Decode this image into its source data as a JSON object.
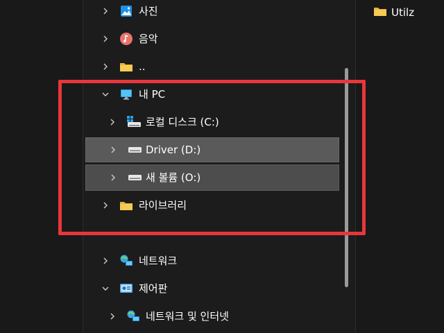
{
  "nav": {
    "items": [
      {
        "label": "사진",
        "icon": "photos-icon",
        "expanded": false
      },
      {
        "label": "음악",
        "icon": "music-icon",
        "expanded": false
      },
      {
        "label": "..",
        "icon": "folder-icon",
        "expanded": false
      },
      {
        "label": "내 PC",
        "icon": "this-pc-icon",
        "expanded": true
      },
      {
        "label": "로컬 디스크 (C:)",
        "icon": "windows-drive-icon",
        "expanded": false
      },
      {
        "label": "Driver (D:)",
        "icon": "drive-icon",
        "expanded": false,
        "selected": true
      },
      {
        "label": "새 볼륨 (O:)",
        "icon": "drive-icon",
        "expanded": false,
        "hovered": true
      },
      {
        "label": "라이브러리",
        "icon": "library-folder-icon",
        "expanded": false
      },
      {
        "label": "네트워크",
        "icon": "network-icon",
        "expanded": false
      },
      {
        "label": "제어판",
        "icon": "control-panel-icon",
        "expanded": true
      },
      {
        "label": "네트워크 및 인터넷",
        "icon": "network-internet-icon",
        "expanded": false
      }
    ]
  },
  "content": {
    "files": [
      {
        "label": "Utilz",
        "icon": "folder-icon"
      }
    ]
  },
  "colors": {
    "highlight": "#e8363b",
    "selected_bg": "#5a5a5a",
    "folder": "#f4c542"
  }
}
